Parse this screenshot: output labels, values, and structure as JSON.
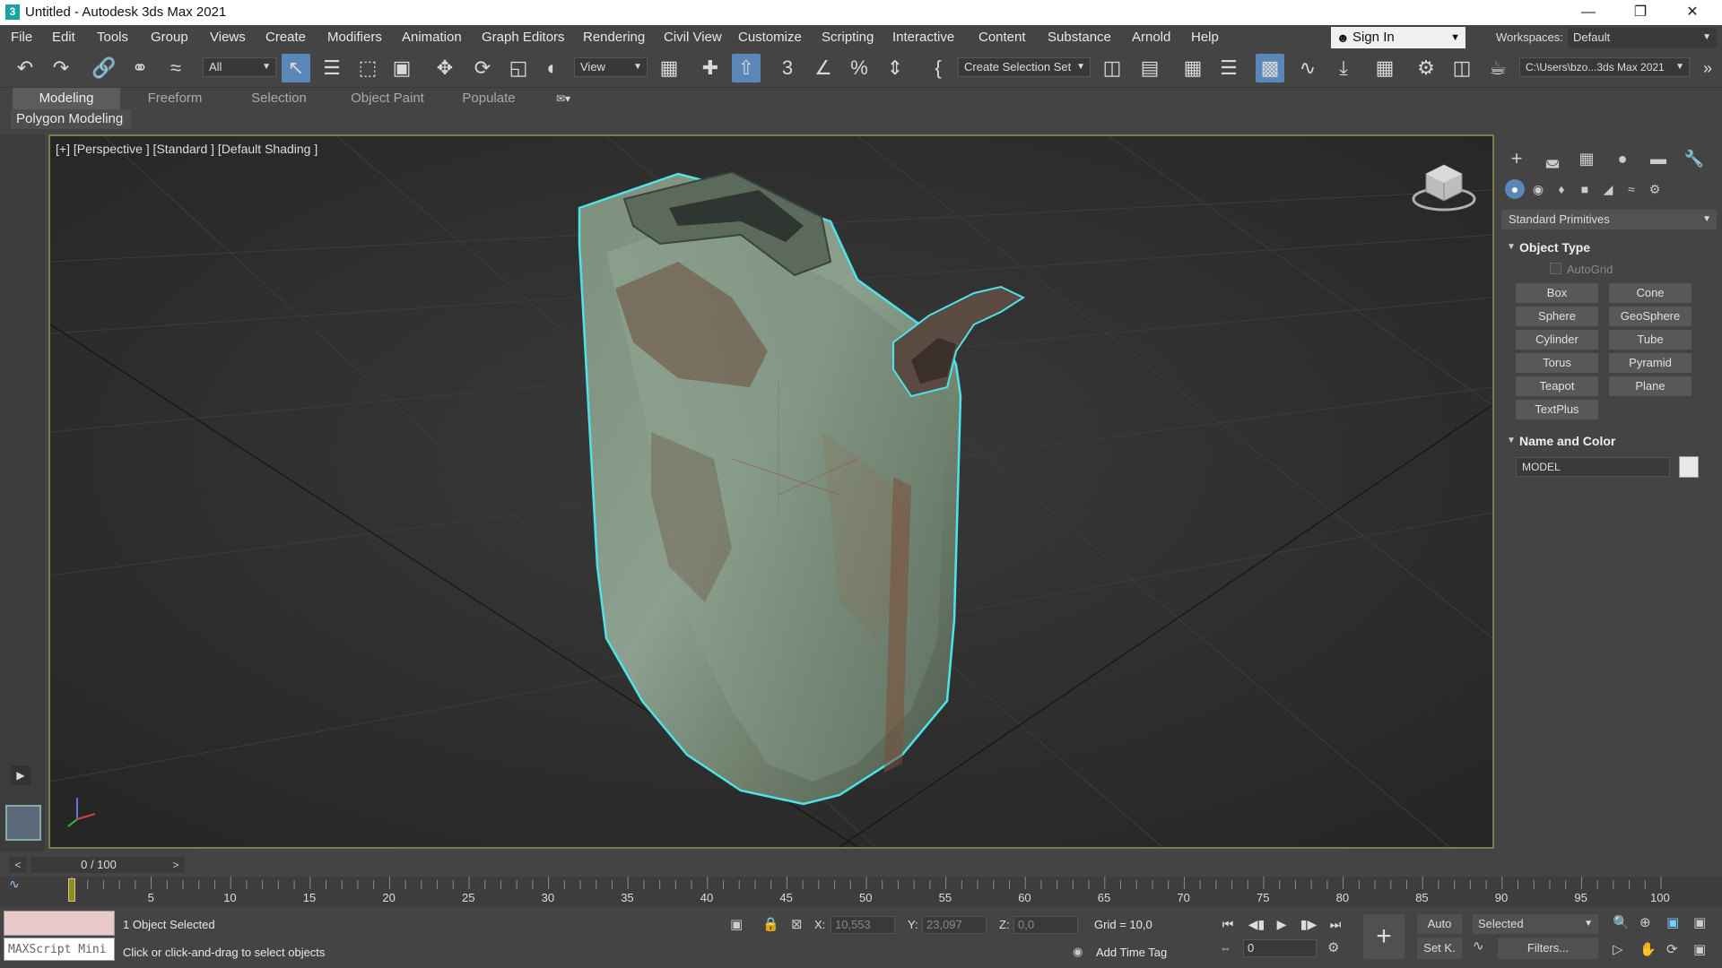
{
  "window": {
    "title": "Untitled - Autodesk 3ds Max 2021",
    "app_icon": "3"
  },
  "menu": {
    "items": [
      "File",
      "Edit",
      "Tools",
      "Group",
      "Views",
      "Create",
      "Modifiers",
      "Animation",
      "Graph Editors",
      "Rendering",
      "Civil View",
      "Customize",
      "Scripting",
      "Interactive",
      "Content",
      "Substance",
      "Arnold",
      "Help"
    ],
    "sign_in": "Sign In",
    "workspaces_label": "Workspaces:",
    "workspace_value": "Default"
  },
  "toolbar": {
    "filter_value": "All",
    "ref_coord_value": "View",
    "selection_set_value": "Create Selection Set",
    "snap_label": "3",
    "project_path": "C:\\Users\\bzo...3ds Max 2021"
  },
  "ribbon": {
    "tabs": [
      "Modeling",
      "Freeform",
      "Selection",
      "Object Paint",
      "Populate"
    ],
    "active_tab": "Modeling",
    "sub_label": "Polygon Modeling"
  },
  "viewport": {
    "label": "[+] [Perspective ] [Standard ] [Default Shading ]",
    "axis_label": "z"
  },
  "command_panel": {
    "category": "Standard Primitives",
    "object_type_title": "Object Type",
    "autogrid_label": "AutoGrid",
    "buttons": [
      "Box",
      "Cone",
      "Sphere",
      "GeoSphere",
      "Cylinder",
      "Tube",
      "Torus",
      "Pyramid",
      "Teapot",
      "Plane",
      "TextPlus"
    ],
    "name_color_title": "Name and Color",
    "name_value": "MODEL",
    "object_color": "#e8e8e8"
  },
  "time_slider": {
    "frame_display": "0 / 100",
    "prev": "<",
    "next": ">"
  },
  "track_bar": {
    "labels": [
      "5",
      "10",
      "15",
      "20",
      "25",
      "30",
      "35",
      "40",
      "45",
      "50",
      "55",
      "60",
      "65",
      "70",
      "75",
      "80",
      "85",
      "90",
      "95",
      "100"
    ],
    "current_frame": "0"
  },
  "status": {
    "maxscript_label": "MAXScript Mini",
    "selection_text": "1 Object Selected",
    "prompt_text": "Click or click-and-drag to select objects",
    "x_label": "X:",
    "x_value": "10,553",
    "y_label": "Y:",
    "y_value": "23,097",
    "z_label": "Z:",
    "z_value": "0,0",
    "grid_text": "Grid = 10,0",
    "add_time_tag": "Add Time Tag",
    "auto_label": "Auto",
    "setk_label": "Set K.",
    "selected_dropdown": "Selected",
    "filters_label": "Filters...",
    "frame_field": "0"
  },
  "colors": {
    "selection_outline": "#4fe3e8",
    "active_blue": "#5a86b8",
    "viewport_border": "#7f7a4c"
  }
}
